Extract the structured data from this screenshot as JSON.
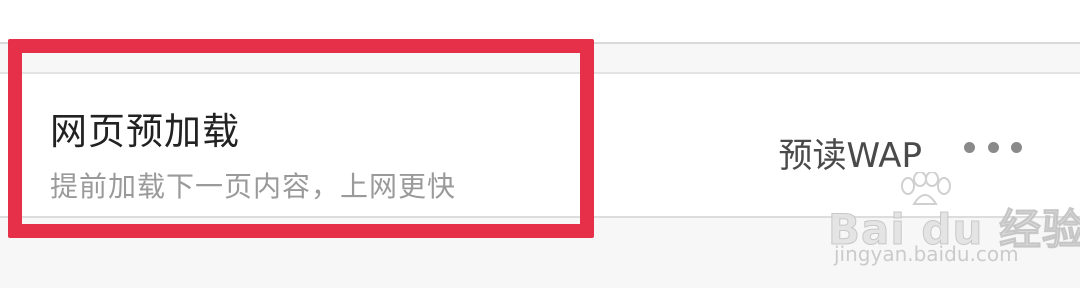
{
  "setting_row": {
    "title": "网页预加载",
    "subtitle": "提前加载下一页内容，上网更快",
    "value": "预读WAP",
    "more_icon": "more-dots-icon"
  },
  "highlight": {
    "color": "#e6304a"
  },
  "watermark": {
    "main_text": "Bai du 经验",
    "url_text": "jingyan.baidu.com",
    "icon": "baidu-paw-icon"
  },
  "colors": {
    "title": "#222222",
    "subtitle": "#9a9a9a",
    "value": "#4a4a4a",
    "row_background": "#ffffff",
    "page_background": "#f7f7f7"
  }
}
